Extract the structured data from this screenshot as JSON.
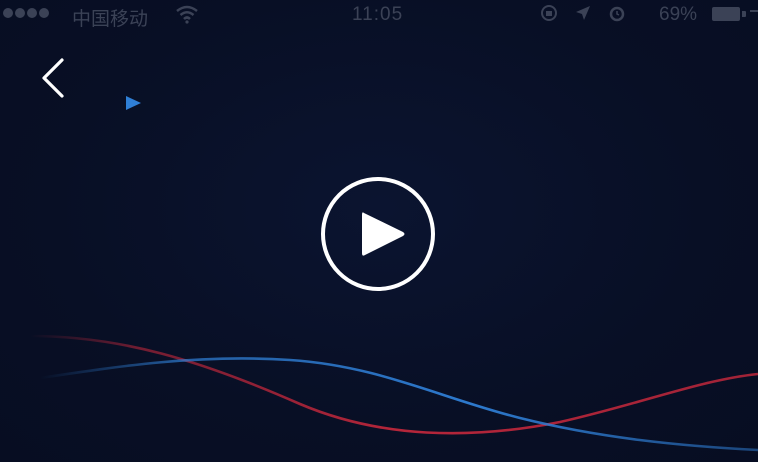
{
  "status_bar": {
    "carrier": "中国移动",
    "time": "11:05",
    "battery_percent": "69%",
    "signal_icon": "signal-dots-icon",
    "wifi_icon": "wifi-icon",
    "icons": [
      "location-icon",
      "alarm-icon",
      "lock-rotation-icon"
    ]
  },
  "player": {
    "back_icon": "chevron-left-icon",
    "small_play_icon": "play-triangle-icon",
    "play_icon": "play-circle-icon"
  },
  "colors": {
    "background": "#080f25",
    "wave_blue": "#2f7fd6",
    "wave_red": "#c8283c",
    "icon_white": "#ffffff"
  }
}
